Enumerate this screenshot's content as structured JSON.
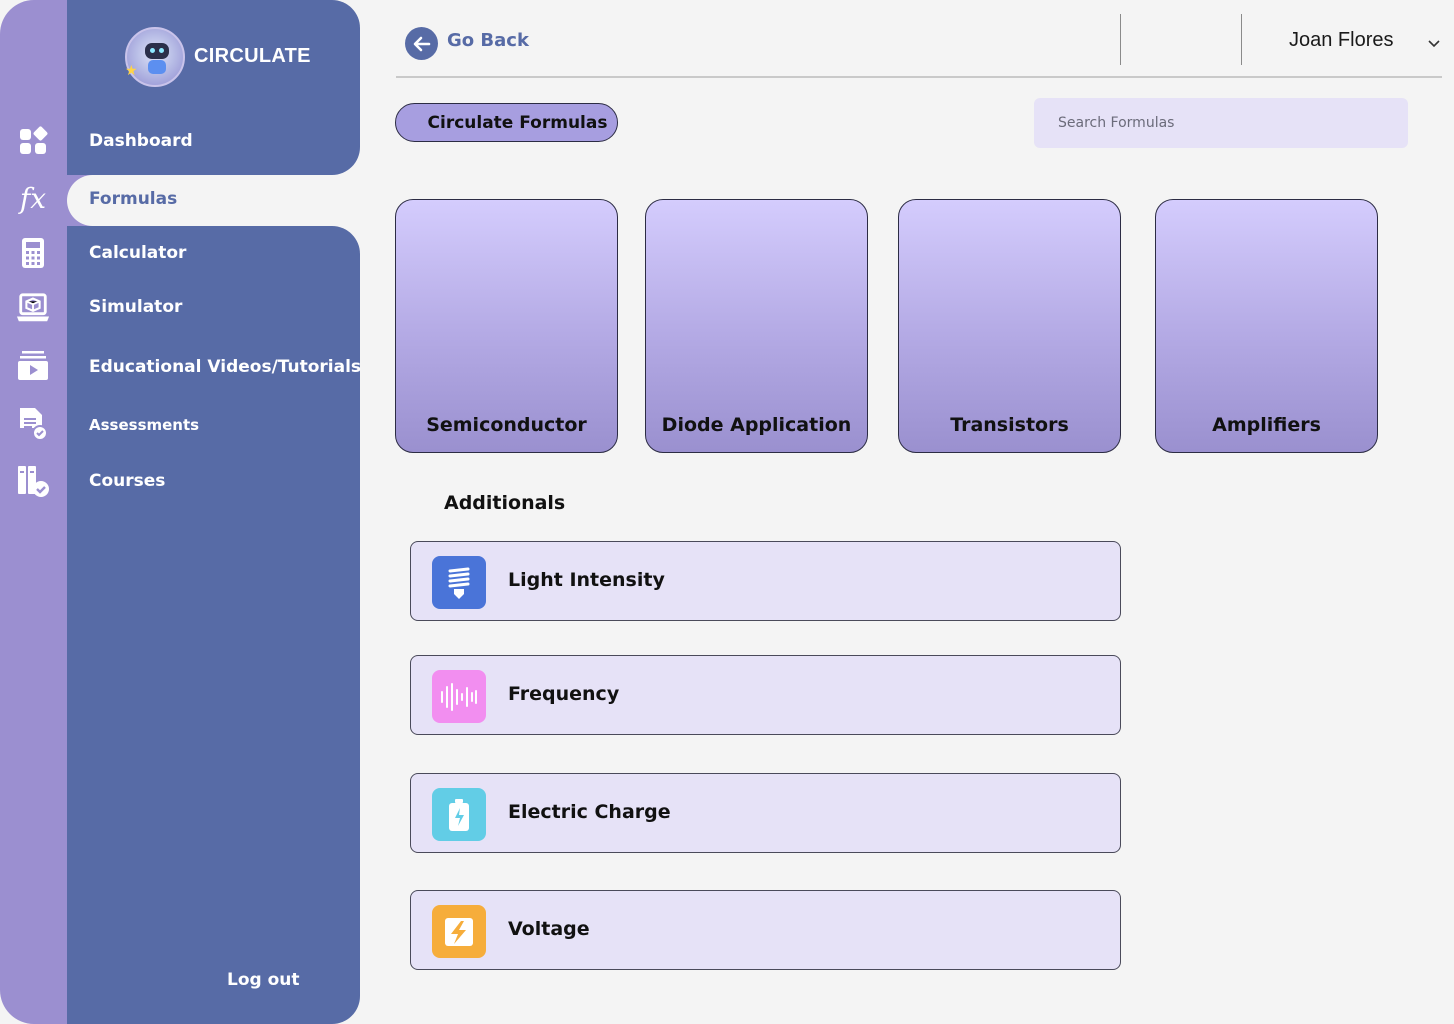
{
  "brand": {
    "name": "CIRCULATE",
    "logo_icon": "robot-logo-icon"
  },
  "sidebar": {
    "items": [
      {
        "label": "Dashboard",
        "icon": "dashboard-icon"
      },
      {
        "label": "Formulas",
        "icon": "function-icon",
        "active": true
      },
      {
        "label": "Calculator",
        "icon": "calculator-icon"
      },
      {
        "label": "Simulator",
        "icon": "laptop-box-icon"
      },
      {
        "label": "Educational Videos/Tutorials",
        "icon": "video-icon"
      },
      {
        "label": "Assessments",
        "icon": "assessment-icon"
      },
      {
        "label": "Courses",
        "icon": "courses-icon"
      }
    ],
    "logout_label": "Log out"
  },
  "header": {
    "back_label": "Go Back",
    "user_name": "Joan Flores"
  },
  "main": {
    "tab_label": "Circulate Formulas",
    "search_placeholder": "Search Formulas",
    "categories": [
      {
        "label": "Semiconductor"
      },
      {
        "label": "Diode Application"
      },
      {
        "label": "Transistors"
      },
      {
        "label": "Amplifiers"
      }
    ],
    "additionals_title": "Additionals",
    "additionals": [
      {
        "label": "Light Intensity",
        "icon": "light-bulb-icon",
        "color": "#4a74d8"
      },
      {
        "label": "Frequency",
        "icon": "sound-wave-icon",
        "color": "#f28ef0"
      },
      {
        "label": "Electric Charge",
        "icon": "battery-charge-icon",
        "color": "#62cde6"
      },
      {
        "label": "Voltage",
        "icon": "lightning-icon",
        "color": "#f6ad3b"
      }
    ]
  },
  "colors": {
    "sidebar": "#576ba6",
    "rail": "#9b8fd0",
    "accent": "#a79ee0",
    "background": "#f4f4f4"
  }
}
